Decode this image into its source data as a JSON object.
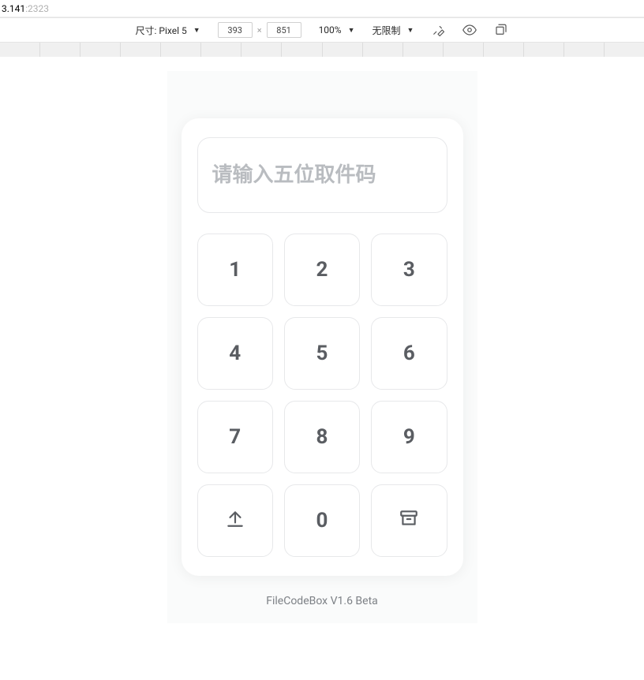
{
  "addr": {
    "host": "3.141",
    "port": ":2323"
  },
  "devtools": {
    "device_label": "尺寸: Pixel 5",
    "width": "393",
    "height": "851",
    "zoom": "100%",
    "throttle": "无限制"
  },
  "app": {
    "input_placeholder": "请输入五位取件码",
    "input_value": "",
    "keys": [
      "1",
      "2",
      "3",
      "4",
      "5",
      "6",
      "7",
      "8",
      "9",
      "upload",
      "0",
      "archive"
    ],
    "footer": "FileCodeBox V1.6 Beta"
  }
}
